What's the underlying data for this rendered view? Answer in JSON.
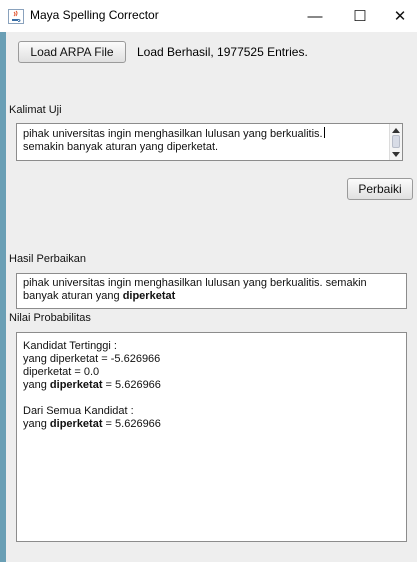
{
  "window": {
    "title": "Maya Spelling Corrector",
    "controls": {
      "minimize": "—",
      "maximize": "☐",
      "close": "✕"
    },
    "icon": "java-cup-icon"
  },
  "toolbar": {
    "load_button": "Load ARPA File",
    "status": "Load Berhasil, 1977525 Entries."
  },
  "input_section": {
    "label": "Kalimat Uji",
    "text_line1": "pihak universitas ingin menghasilkan lulusan yang berkualitis.",
    "text_line2": "semakin banyak aturan yang diperketat.",
    "button": "Perbaiki"
  },
  "result_section": {
    "label": "Hasil Perbaikan",
    "line1": "pihak universitas ingin menghasilkan lulusan yang berkualitis. semakin",
    "line2_prefix": "banyak aturan yang ",
    "line2_bold": "diperketat"
  },
  "probability_section": {
    "label": "Nilai Probabilitas",
    "top_header": "Kandidat Tertinggi :",
    "top_line1": "yang diperketat = -5.626966",
    "top_line2": "diperketat = 0.0",
    "top_line3_prefix": "yang ",
    "top_line3_bold": "diperketat",
    "top_line3_suffix": " = 5.626966",
    "all_header": "Dari Semua Kandidat :",
    "all_line1_prefix": "yang ",
    "all_line1_bold": "diperketat",
    "all_line1_suffix": " = 5.626966"
  }
}
